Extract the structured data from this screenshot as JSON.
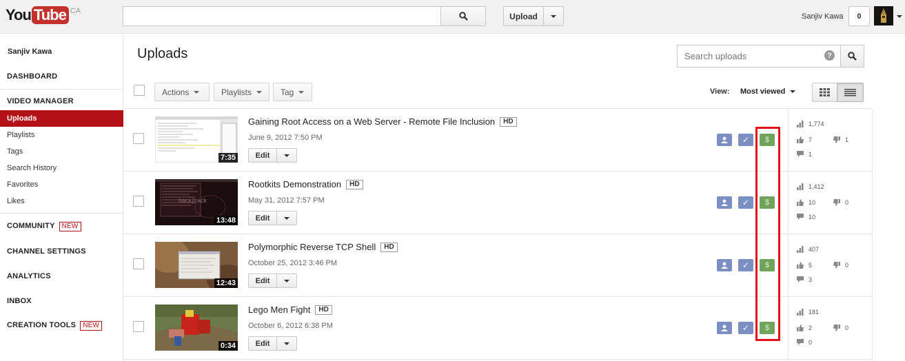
{
  "header": {
    "logo_you": "You",
    "logo_tube": "Tube",
    "logo_region": "CA",
    "upload_label": "Upload",
    "user_name": "Sanjiv Kawa",
    "notification_count": "0"
  },
  "sidebar": {
    "user_name": "Sanjiv Kawa",
    "dashboard": "DASHBOARD",
    "video_manager": "VIDEO MANAGER",
    "items": [
      {
        "label": "Uploads"
      },
      {
        "label": "Playlists"
      },
      {
        "label": "Tags"
      },
      {
        "label": "Search History"
      },
      {
        "label": "Favorites"
      },
      {
        "label": "Likes"
      }
    ],
    "community": "COMMUNITY",
    "channel_settings": "CHANNEL SETTINGS",
    "analytics": "ANALYTICS",
    "inbox": "INBOX",
    "creation_tools": "CREATION TOOLS",
    "new_badge": "NEW"
  },
  "main": {
    "title": "Uploads",
    "search_placeholder": "Search uploads",
    "help": "?",
    "toolbar": {
      "actions": "Actions",
      "playlists": "Playlists",
      "tag": "Tag"
    },
    "view_label": "View:",
    "view_value": "Most viewed"
  },
  "videos": [
    {
      "title": "Gaining Root Access on a Web Server - Remote File Inclusion",
      "hd": "HD",
      "date": "June 9, 2012 7:50 PM",
      "duration": "7:35",
      "views": "1,774",
      "likes": "7",
      "dislikes": "1",
      "comments": "1",
      "edit_label": "Edit"
    },
    {
      "title": "Rootkits Demonstration",
      "hd": "HD",
      "date": "May 31, 2012 7:57 PM",
      "duration": "13:48",
      "views": "1,412",
      "likes": "10",
      "dislikes": "0",
      "comments": "10",
      "edit_label": "Edit"
    },
    {
      "title": "Polymorphic Reverse TCP Shell",
      "hd": "HD",
      "date": "October 25, 2012 3:46 PM",
      "duration": "12:43",
      "views": "407",
      "likes": "5",
      "dislikes": "0",
      "comments": "3",
      "edit_label": "Edit"
    },
    {
      "title": "Lego Men Fight",
      "hd": "HD",
      "date": "October 6, 2012 6:38 PM",
      "duration": "0:34",
      "views": "181",
      "likes": "2",
      "dislikes": "0",
      "comments": "0",
      "edit_label": "Edit"
    }
  ],
  "icon_names": {
    "privacy": "person-privacy-icon",
    "check": "checkmark-icon",
    "monetize": "dollar-icon",
    "views": "bar-chart-icon",
    "likes": "thumbs-up-icon",
    "dislikes": "thumbs-down-icon",
    "comments": "comment-icon"
  },
  "colors": {
    "brand_red": "#c4302b",
    "active_nav": "#b31217",
    "status_blue": "#7b8fc2",
    "monetize_green": "#72a35d",
    "highlight_red": "#e0131a"
  }
}
